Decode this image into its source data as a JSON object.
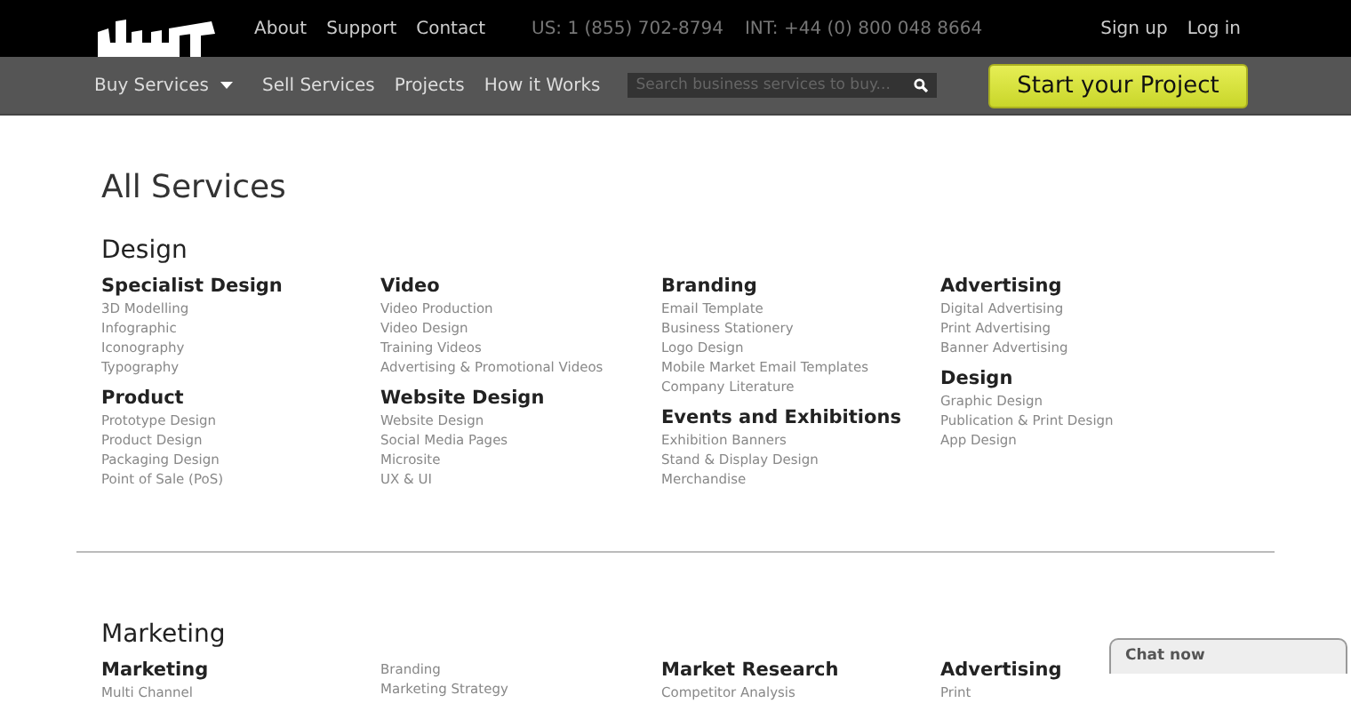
{
  "top_bar": {
    "links": [
      "About",
      "Support",
      "Contact"
    ],
    "phones": [
      "US: 1 (855) 702-8794",
      "INT: +44 (0) 800 048 8664"
    ],
    "account_links": [
      "Sign up",
      "Log in"
    ]
  },
  "nav": {
    "dropdown": "Buy Services",
    "links": [
      "Sell Services",
      "Projects",
      "How it Works"
    ],
    "search": {
      "placeholder": "Search business services to buy..."
    },
    "cta": "Start your Project"
  },
  "page_title": "All Services",
  "sections": [
    {
      "title": "Design",
      "columns": [
        [
          {
            "heading": "Specialist Design",
            "items": [
              "3D Modelling",
              "Infographic",
              "Iconography",
              "Typography"
            ]
          },
          {
            "heading": "Product",
            "items": [
              "Prototype Design",
              "Product Design",
              "Packaging Design",
              "Point of Sale (PoS)"
            ]
          }
        ],
        [
          {
            "heading": "Video",
            "items": [
              "Video Production",
              "Video Design",
              "Training Videos",
              "Advertising & Promotional Videos"
            ]
          },
          {
            "heading": "Website Design",
            "items": [
              "Website Design",
              "Social Media Pages",
              "Microsite",
              "UX & UI"
            ]
          }
        ],
        [
          {
            "heading": "Branding",
            "items": [
              "Email Template",
              "Business Stationery",
              "Logo Design",
              "Mobile Market Email Templates",
              "Company Literature"
            ]
          },
          {
            "heading": "Events and Exhibitions",
            "items": [
              "Exhibition Banners",
              "Stand & Display Design",
              "Merchandise"
            ]
          }
        ],
        [
          {
            "heading": "Advertising",
            "items": [
              "Digital Advertising",
              "Print Advertising",
              "Banner Advertising"
            ]
          },
          {
            "heading": "Design",
            "items": [
              "Graphic Design",
              "Publication & Print Design",
              "App Design"
            ]
          }
        ]
      ]
    },
    {
      "title": "Marketing",
      "columns": [
        [
          {
            "heading": "Marketing",
            "items": [
              "Multi Channel"
            ]
          }
        ],
        [
          {
            "items": [
              "Branding",
              "Marketing Strategy"
            ]
          }
        ],
        [
          {
            "heading": "Market Research",
            "items": [
              "Competitor Analysis"
            ]
          }
        ],
        [
          {
            "heading": "Advertising",
            "items": [
              "Print"
            ]
          }
        ]
      ]
    }
  ],
  "chat": {
    "label": "Chat now"
  }
}
